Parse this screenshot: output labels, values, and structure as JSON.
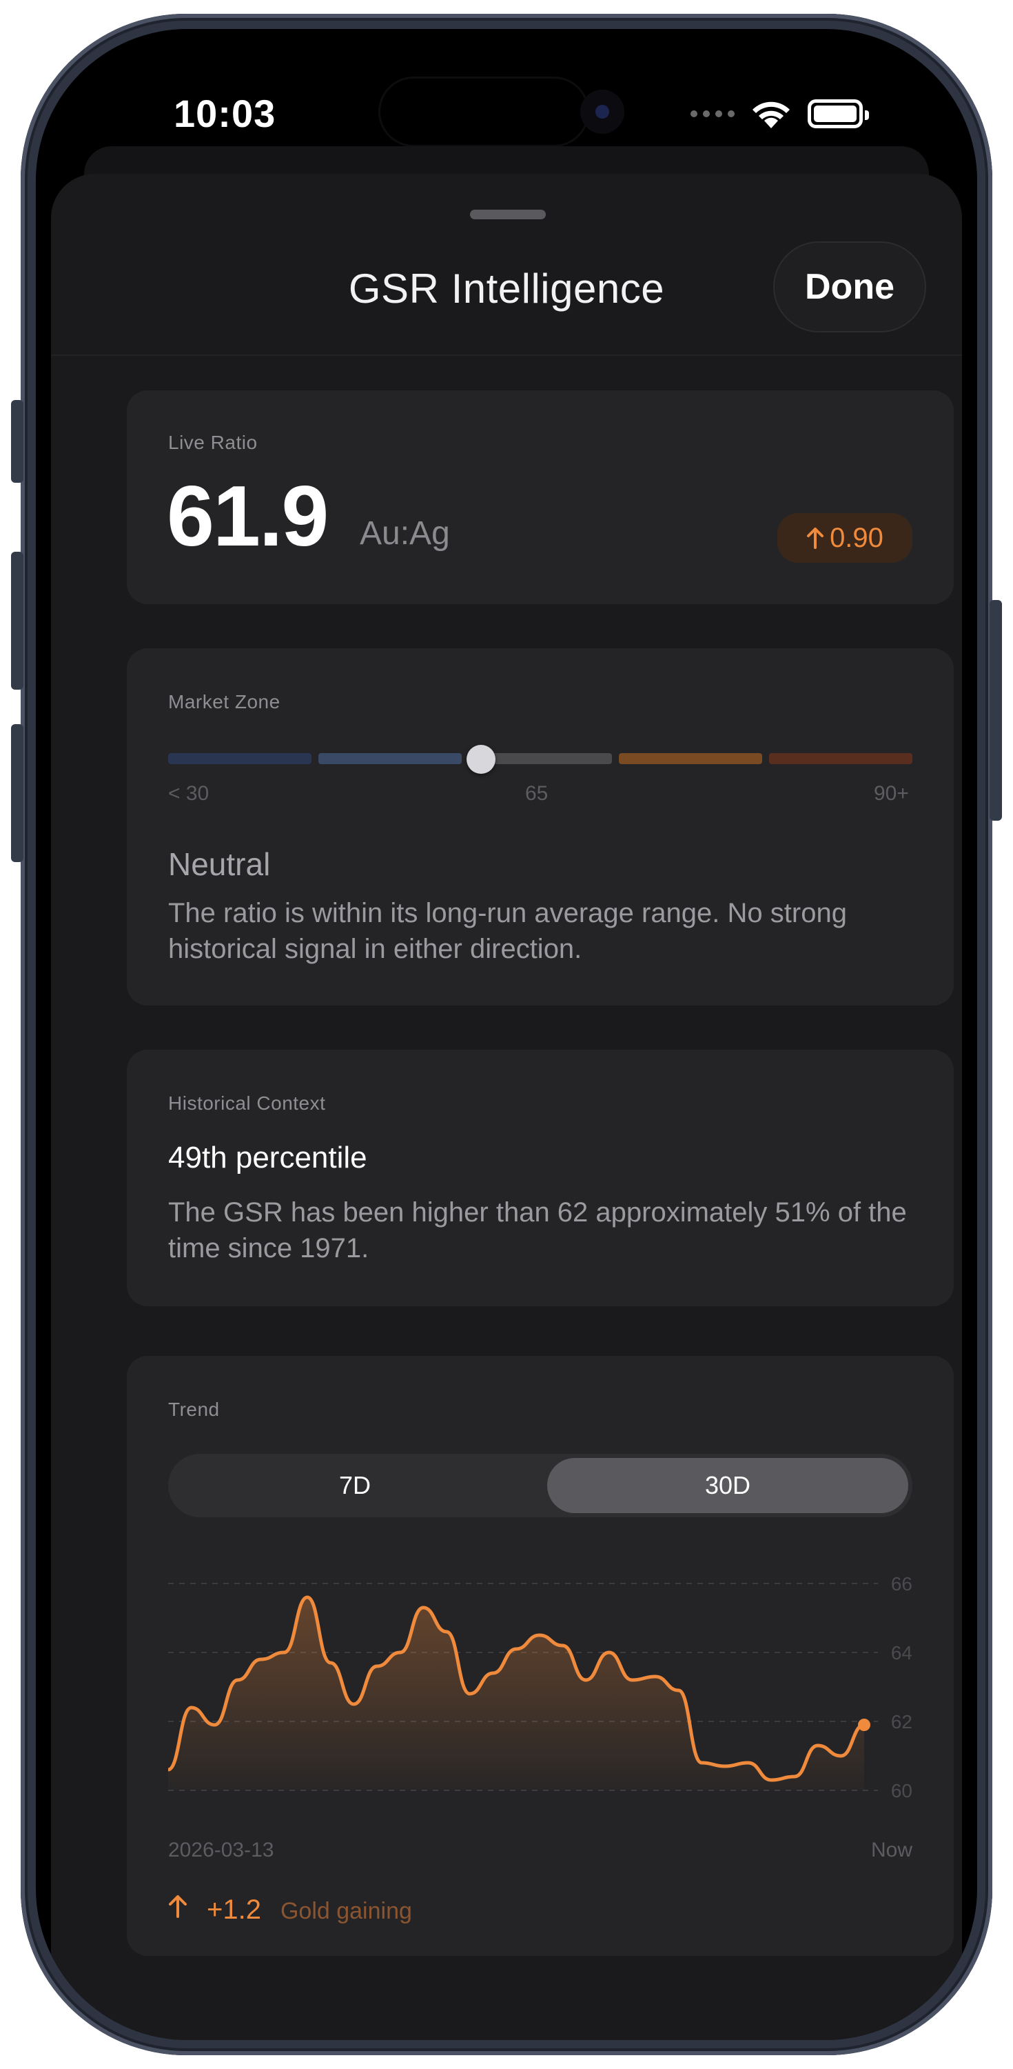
{
  "status_bar": {
    "time": "10:03"
  },
  "sheet": {
    "title": "GSR Intelligence",
    "done_label": "Done"
  },
  "live_ratio": {
    "label": "Live Ratio",
    "value": "61.9",
    "unit": "Au:Ag",
    "change": "0.90",
    "change_direction": "up"
  },
  "market_zone": {
    "label": "Market Zone",
    "ticks": [
      "< 30",
      "65",
      "90+"
    ],
    "marker_fraction": 0.42,
    "segment_colors": [
      "#2a3552",
      "#3a4a66",
      "#4a4a4c",
      "#7a4a22",
      "#5a2e1e"
    ],
    "zone_name": "Neutral",
    "description": "The ratio is within its long-run average range. No strong historical signal in either direction."
  },
  "historical": {
    "label": "Historical Context",
    "title": "49th percentile",
    "description": "The GSR has been higher than 62 approximately 51% of the time since 1971."
  },
  "trend": {
    "label": "Trend",
    "ranges": [
      "7D",
      "30D"
    ],
    "selected_range": "30D",
    "x_start": "2026-03-13",
    "x_end": "Now",
    "delta": "+1.2",
    "delta_label": "Gold gaining"
  },
  "chart_data": {
    "type": "area",
    "y_ticks": [
      66,
      64,
      62,
      60
    ],
    "ylim": [
      60,
      66
    ],
    "grid": true,
    "color": "#f08a3c",
    "values": [
      60.6,
      62.4,
      61.9,
      63.2,
      63.8,
      64.0,
      65.6,
      63.7,
      62.5,
      63.6,
      64.0,
      65.3,
      64.6,
      62.8,
      63.4,
      64.1,
      64.5,
      64.2,
      63.2,
      64.0,
      63.2,
      63.3,
      62.9,
      60.8,
      60.7,
      60.8,
      60.3,
      60.4,
      61.3,
      61.0,
      61.9
    ]
  },
  "colors": {
    "accent": "#f08a3c",
    "card": "#242426",
    "sheet": "#1a1a1c"
  }
}
